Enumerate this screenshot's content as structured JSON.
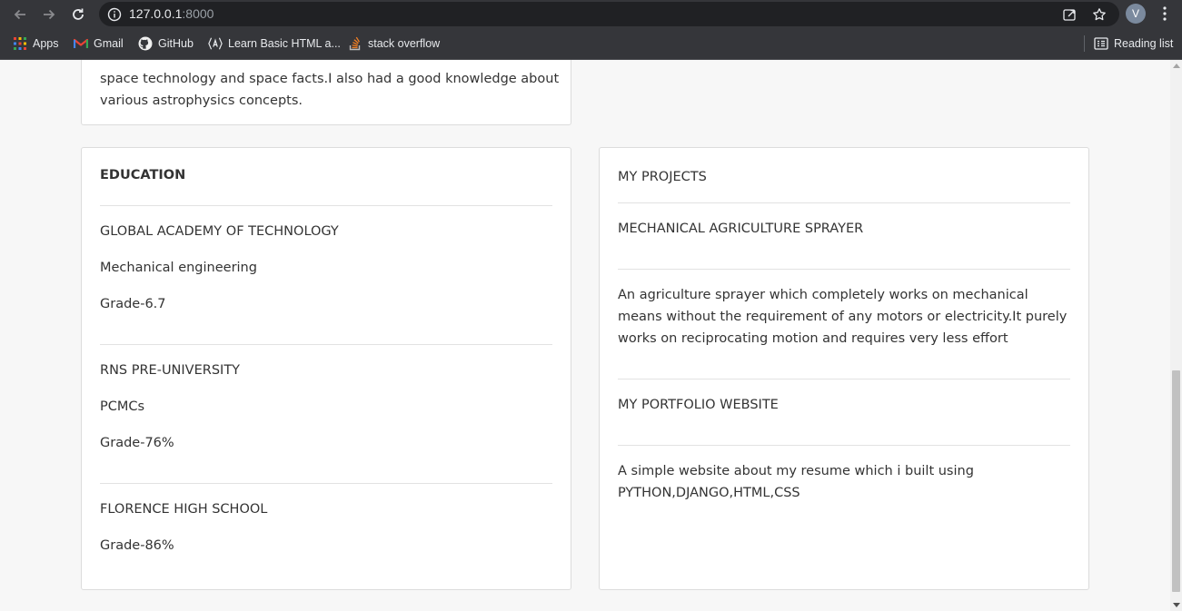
{
  "browser": {
    "url_host": "127.0.0.1",
    "url_port": ":8000",
    "avatar_letter": "V",
    "bookmarks": [
      {
        "label": "Apps",
        "icon": "apps-grid-icon"
      },
      {
        "label": "Gmail",
        "icon": "gmail-icon"
      },
      {
        "label": "GitHub",
        "icon": "github-icon"
      },
      {
        "label": "Learn Basic HTML a...",
        "icon": "learn-html-icon"
      },
      {
        "label": "stack overflow",
        "icon": "stackoverflow-icon"
      }
    ],
    "reading_list": "Reading list"
  },
  "about": {
    "line1": "space technology and space facts.I also had a good knowledge about",
    "line2": "various astrophysics concepts."
  },
  "education": {
    "heading": "EDUCATION",
    "entries": [
      {
        "institution": "GLOBAL ACADEMY OF TECHNOLOGY",
        "course": "Mechanical engineering",
        "grade": "Grade-6.7"
      },
      {
        "institution": "RNS PRE-UNIVERSITY",
        "course": "PCMCs",
        "grade": "Grade-76%"
      },
      {
        "institution": "FLORENCE HIGH SCHOOL",
        "grade": "Grade-86%"
      }
    ]
  },
  "projects": {
    "heading": "MY PROJECTS",
    "items": [
      {
        "title": "MECHANICAL AGRICULTURE SPRAYER",
        "description": "An agriculture sprayer which completely works on mechanical means without the requirement of any motors or electricity.It purely works on reciprocating motion and requires very less effort"
      },
      {
        "title": "MY PORTFOLIO WEBSITE",
        "description": "A simple website about my resume which i built using PYTHON,DJANGO,HTML,CSS"
      }
    ]
  },
  "colors": {
    "chrome_bg": "#35363a",
    "omnibox_bg": "#202124",
    "page_bg": "#f7f7f7",
    "card_bg": "#ffffff",
    "text": "#333333"
  }
}
